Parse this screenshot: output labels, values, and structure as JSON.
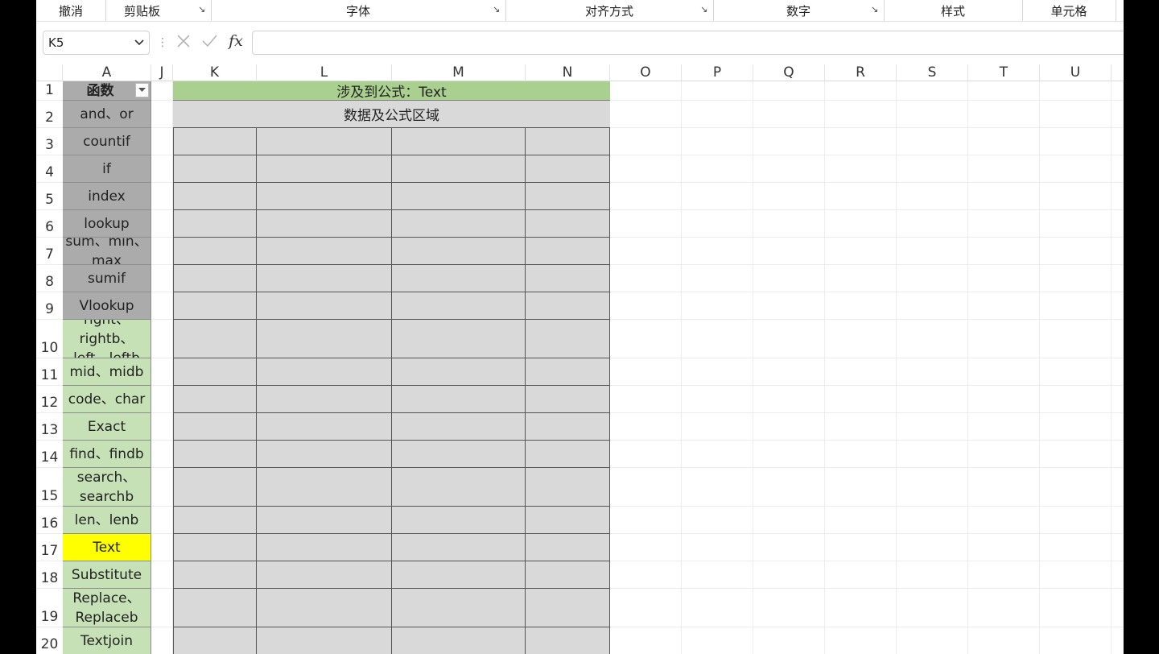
{
  "ribbon": {
    "groups": [
      {
        "label": "撤消",
        "launcher": false
      },
      {
        "label": "剪贴板",
        "launcher": true
      },
      {
        "label": "字体",
        "launcher": true
      },
      {
        "label": "对齐方式",
        "launcher": true
      },
      {
        "label": "数字",
        "launcher": true
      },
      {
        "label": "样式",
        "launcher": false
      },
      {
        "label": "单元格",
        "launcher": false
      }
    ]
  },
  "formula_bar": {
    "name_box": "K5",
    "fx_label": "fx",
    "formula": ""
  },
  "columns": [
    "A",
    "J",
    "K",
    "L",
    "M",
    "N",
    "O",
    "P",
    "Q",
    "R",
    "S",
    "T",
    "U"
  ],
  "rows": [
    "1",
    "2",
    "3",
    "4",
    "5",
    "6",
    "7",
    "8",
    "9",
    "10",
    "11",
    "12",
    "13",
    "14",
    "15",
    "16",
    "17",
    "18",
    "19",
    "20"
  ],
  "col_a": {
    "header": "函数",
    "items": [
      {
        "text": "and、or",
        "fill": "gray"
      },
      {
        "text": "countif",
        "fill": "gray"
      },
      {
        "text": "if",
        "fill": "gray"
      },
      {
        "text": "index",
        "fill": "gray"
      },
      {
        "text": "lookup",
        "fill": "gray"
      },
      {
        "text": "sum、min、max",
        "fill": "gray"
      },
      {
        "text": "sumif",
        "fill": "gray"
      },
      {
        "text": "Vlookup",
        "fill": "gray"
      },
      {
        "text": "right、rightb、left、leftb",
        "fill": "green"
      },
      {
        "text": "mid、midb",
        "fill": "green"
      },
      {
        "text": "code、char",
        "fill": "green"
      },
      {
        "text": "Exact",
        "fill": "green"
      },
      {
        "text": "find、findb",
        "fill": "green"
      },
      {
        "text": "search、searchb",
        "fill": "green"
      },
      {
        "text": "len、lenb",
        "fill": "green"
      },
      {
        "text": "Text",
        "fill": "yellow"
      },
      {
        "text": "Substitute",
        "fill": "green"
      },
      {
        "text": "Replace、Replaceb",
        "fill": "green"
      },
      {
        "text": "Textjoin",
        "fill": "green"
      }
    ]
  },
  "region": {
    "title": "涉及到公式：Text",
    "subtitle": "数据及公式区域"
  },
  "colors": {
    "gray_fill": "#ababab",
    "green_fill": "#c7e1b7",
    "yellow_fill": "#ffff00",
    "title_fill": "#a9d08e",
    "data_fill": "#d9d9d9"
  }
}
